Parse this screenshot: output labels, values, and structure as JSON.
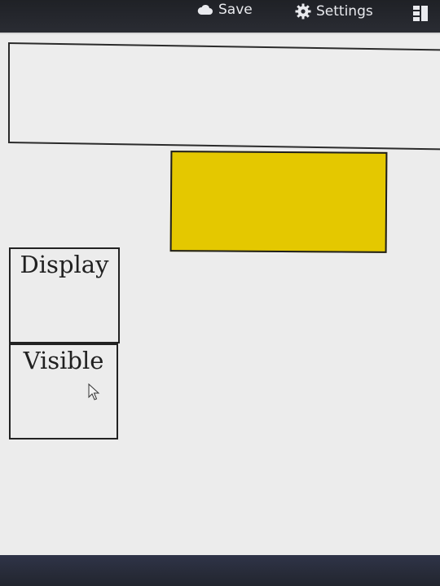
{
  "toolbar": {
    "save_label": "Save",
    "save_icon": "cloud-icon",
    "settings_label": "Settings",
    "settings_icon": "gear-icon",
    "layout_icon": "layout-icon"
  },
  "canvas": {
    "top_box_color": "#ededed",
    "yellow_box_color": "#e4c800",
    "display_box_label": "Display",
    "visible_box_label": "Visible"
  }
}
